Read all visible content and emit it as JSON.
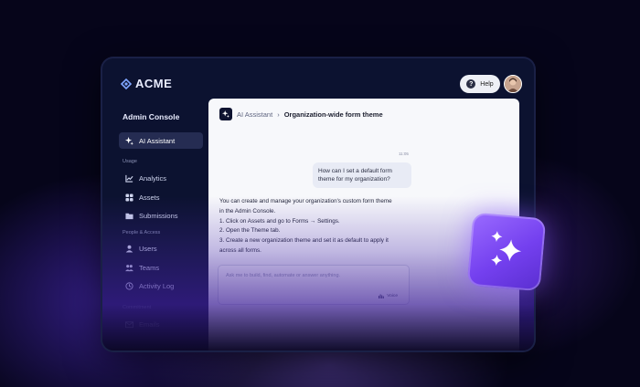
{
  "brand": {
    "name": "ACME"
  },
  "header": {
    "help_label": "Help"
  },
  "sidebar": {
    "title": "Admin Console",
    "active_item": {
      "label": "AI Assistant",
      "icon": "sparkle-icon"
    },
    "sections": [
      {
        "label": "Usage",
        "items": [
          {
            "label": "Analytics",
            "icon": "analytics-icon"
          },
          {
            "label": "Assets",
            "icon": "assets-icon"
          },
          {
            "label": "Submissions",
            "icon": "submissions-icon"
          }
        ]
      },
      {
        "label": "People & Access",
        "items": [
          {
            "label": "Users",
            "icon": "users-icon"
          },
          {
            "label": "Teams",
            "icon": "teams-icon"
          },
          {
            "label": "Activity Log",
            "icon": "activity-log-icon"
          }
        ]
      },
      {
        "label": "Commitment",
        "items": [
          {
            "label": "Emails",
            "icon": "emails-icon"
          }
        ]
      }
    ]
  },
  "main": {
    "breadcrumb": {
      "parent": "AI Assistant",
      "separator": "›",
      "current": "Organization-wide form theme"
    },
    "conversation": {
      "user_message": {
        "time": "11:05",
        "text": "How can I set a default form theme for my organization?"
      },
      "assistant_message": {
        "lines": [
          "You can create and manage your organization's custom form theme",
          "in the Admin Console.",
          "1.  Click on Assets and go to Forms → Settings.",
          "2.  Open the Theme tab.",
          "3.  Create a new organization theme and set it as default to apply it",
          "across all forms."
        ]
      }
    },
    "input": {
      "placeholder": "Ask me to build, find, automate or answer anything.",
      "voice_label": "Voice"
    }
  },
  "colors": {
    "accent": "#7a48f2",
    "sidebar_bg": "#0c1230",
    "panel_bg": "#f7f8fb"
  }
}
